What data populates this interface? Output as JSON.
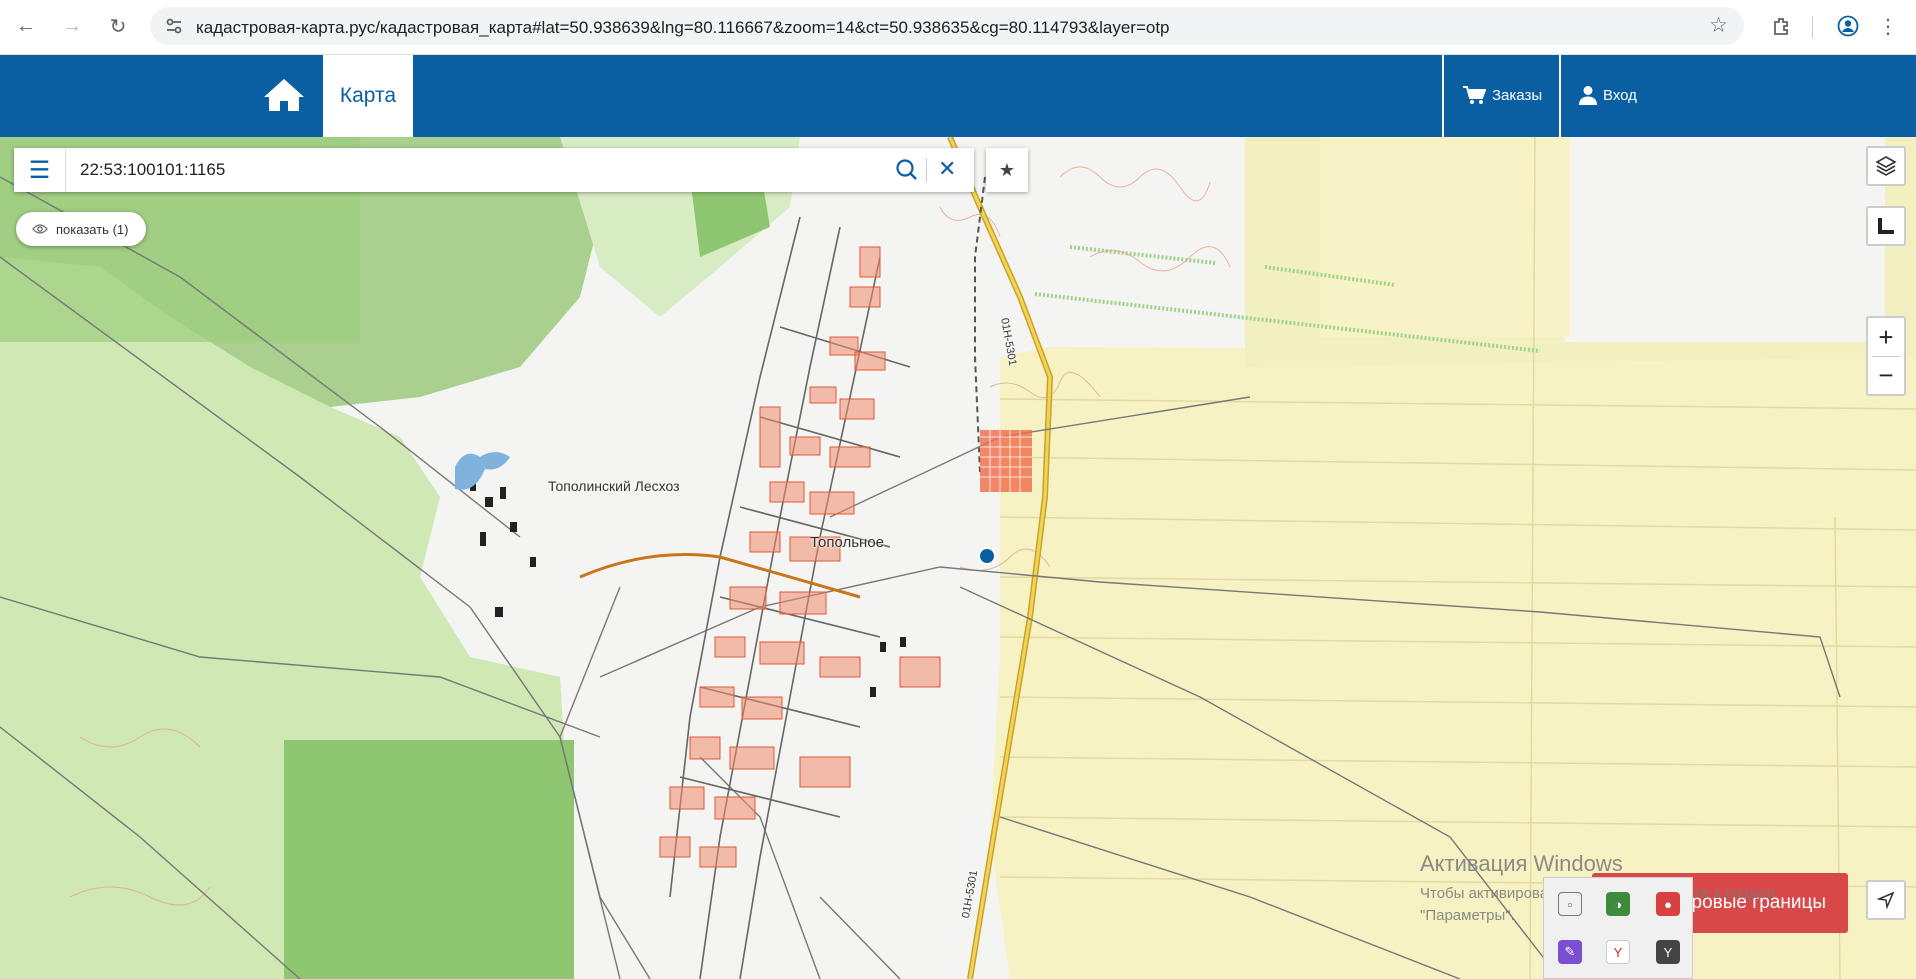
{
  "browser": {
    "url": "кадастровая-карта.рус/кадастровая_карта#lat=50.938639&lng=80.116667&zoom=14&ct=50.938635&cg=80.114793&layer=otp",
    "back_icon": "arrow-left-icon",
    "forward_icon": "arrow-right-icon",
    "reload_icon": "reload-icon"
  },
  "header": {
    "map_tab": "Карта",
    "orders_label": "Заказы",
    "login_label": "Вход",
    "brand_color": "#0a5fa3"
  },
  "search": {
    "value": "22:53:100101:1165"
  },
  "show_button": {
    "label": "показать (1)"
  },
  "map": {
    "labels": {
      "forestry": "Тополинский Лесхоз",
      "village": "Топольное",
      "road_north": "01Н-5301",
      "road_south": "01Н-5301"
    },
    "marker_color": "#0a5fa3"
  },
  "bottom": {
    "boundaries_label": "ровые границы",
    "windows_title": "Активация Windows",
    "windows_line1": "Чтобы активировать Windows, перейдите в раздел",
    "windows_line2": "\"Параметры\"."
  }
}
